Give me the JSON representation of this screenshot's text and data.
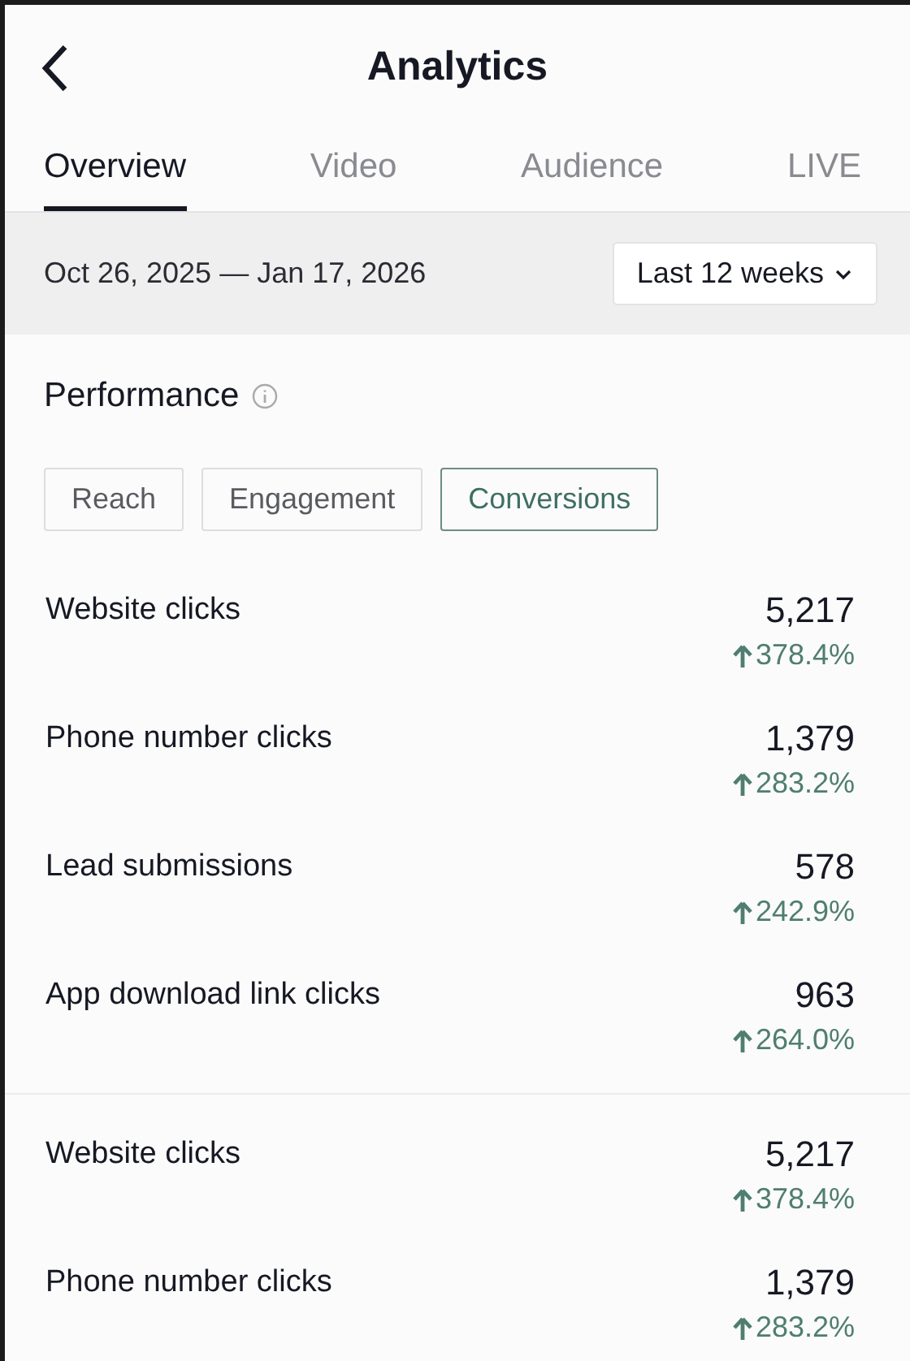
{
  "header": {
    "title": "Analytics"
  },
  "tabs": [
    {
      "label": "Overview",
      "selected": true
    },
    {
      "label": "Video",
      "selected": false
    },
    {
      "label": "Audience",
      "selected": false
    },
    {
      "label": "LIVE",
      "selected": false
    }
  ],
  "date_range": {
    "text": "Oct 26, 2025 — Jan 17, 2026",
    "dropdown": "Last 12 weeks"
  },
  "performance": {
    "title": "Performance",
    "filters": [
      {
        "label": "Reach",
        "selected": false
      },
      {
        "label": "Engagement",
        "selected": false
      },
      {
        "label": "Conversions",
        "selected": true
      }
    ],
    "metric_groups": [
      [
        {
          "label": "Website clicks",
          "value": "5,217",
          "change": "378.4%",
          "kind": "increase"
        },
        {
          "label": "Phone number clicks",
          "value": "1,379",
          "change": "283.2%",
          "kind": "increase"
        },
        {
          "label": "Lead submissions",
          "value": "578",
          "change": "242.9%",
          "kind": "increase"
        },
        {
          "label": "App download link clicks",
          "value": "963",
          "change": "264.0%",
          "kind": "increase"
        }
      ],
      [
        {
          "label": "Website clicks",
          "value": "5,217",
          "change": "378.4%",
          "kind": "increase"
        },
        {
          "label": "Phone number clicks",
          "value": "1,379",
          "change": "283.2%",
          "kind": "increase"
        }
      ]
    ]
  }
}
